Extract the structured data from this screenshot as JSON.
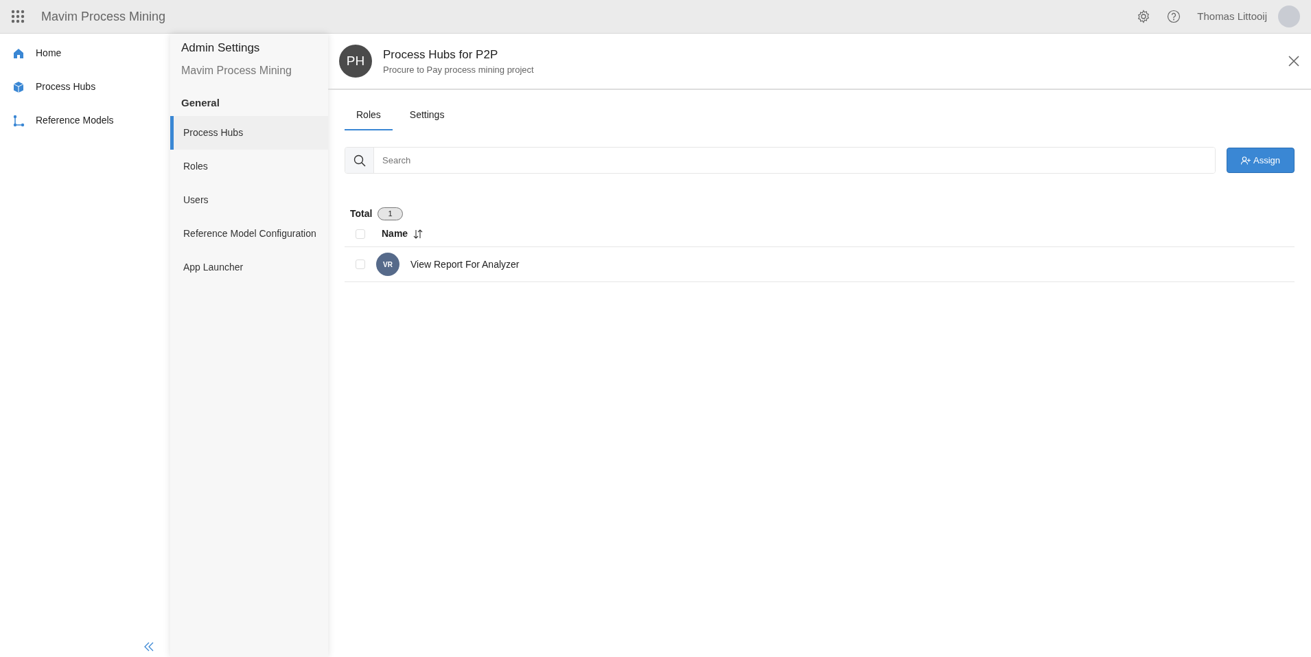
{
  "top_bar": {
    "app_title": "Mavim Process Mining",
    "user_name": "Thomas Littooij"
  },
  "sidebar": {
    "items": [
      {
        "label": "Home",
        "kind": "home",
        "selected": false
      },
      {
        "label": "Process Hubs",
        "kind": "cube",
        "selected": false
      },
      {
        "label": "Reference Models",
        "kind": "model",
        "selected": false
      }
    ]
  },
  "admin_panel": {
    "title": "Admin Settings",
    "subtitle": "Mavim Process Mining",
    "section": "General",
    "items": [
      {
        "label": "Process Hubs",
        "selected": true
      },
      {
        "label": "Roles",
        "selected": false
      },
      {
        "label": "Users",
        "selected": false
      },
      {
        "label": "Reference Model Configuration",
        "selected": false
      },
      {
        "label": "App Launcher",
        "selected": false
      }
    ]
  },
  "hub": {
    "initials": "PH",
    "title": "Process Hubs for P2P",
    "subtitle": "Procure to Pay process mining project"
  },
  "tabs": [
    {
      "label": "Roles",
      "selected": true
    },
    {
      "label": "Settings",
      "selected": false
    }
  ],
  "search": {
    "placeholder": "Search"
  },
  "assign_button": "Assign",
  "total": {
    "label": "Total",
    "count": "1"
  },
  "table": {
    "select_all_checked": false,
    "columns": [
      "Name"
    ],
    "rows": [
      {
        "initials": "VR",
        "name": "View Report For Analyzer",
        "checked": false
      }
    ]
  }
}
